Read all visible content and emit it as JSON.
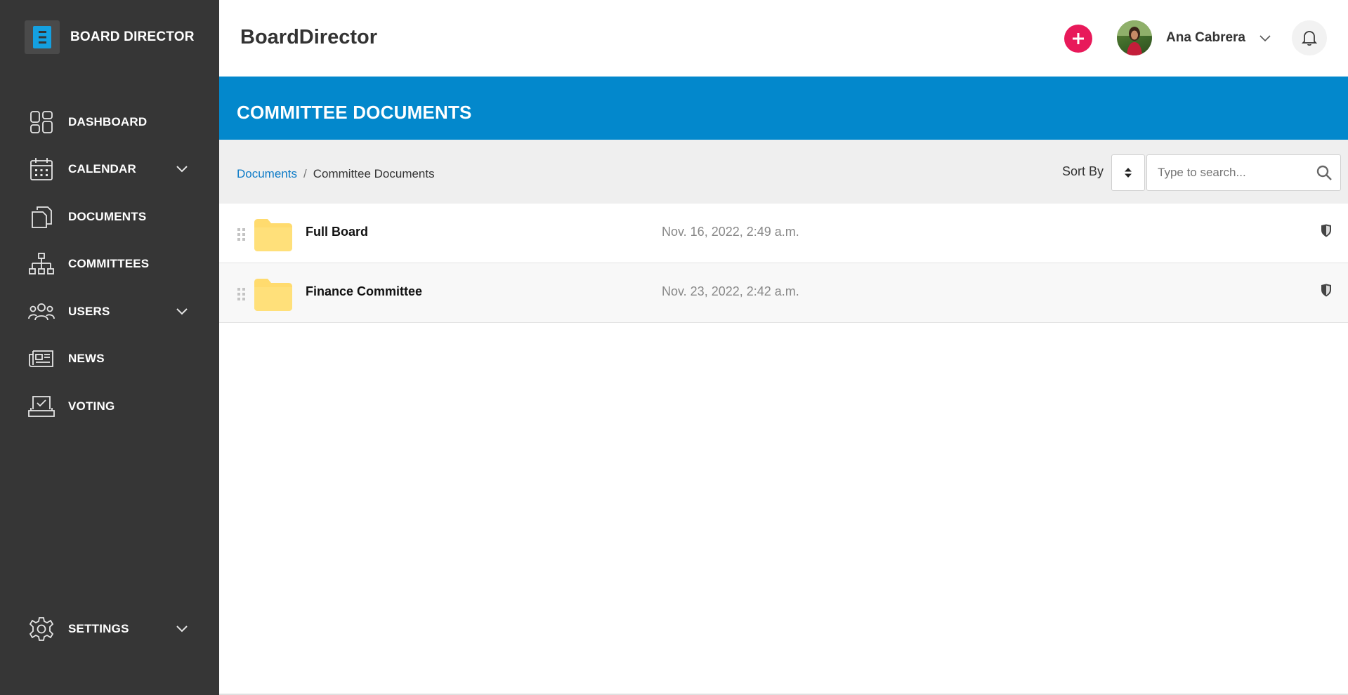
{
  "brand": {
    "name": "BOARD DIRECTOR"
  },
  "sidebar": {
    "items": [
      {
        "label": "DASHBOARD",
        "icon": "dashboard-icon",
        "has_chevron": false
      },
      {
        "label": "CALENDAR",
        "icon": "calendar-icon",
        "has_chevron": true
      },
      {
        "label": "DOCUMENTS",
        "icon": "documents-icon",
        "has_chevron": false
      },
      {
        "label": "COMMITTEES",
        "icon": "org-chart-icon",
        "has_chevron": false
      },
      {
        "label": "USERS",
        "icon": "users-icon",
        "has_chevron": true
      },
      {
        "label": "NEWS",
        "icon": "newspaper-icon",
        "has_chevron": false
      },
      {
        "label": "VOTING",
        "icon": "voting-icon",
        "has_chevron": false
      }
    ],
    "settings": {
      "label": "SETTINGS",
      "icon": "gear-icon",
      "has_chevron": true
    }
  },
  "header": {
    "title": "BoardDirector",
    "user_name": "Ana Cabrera",
    "add_icon": "plus-icon",
    "notifications_icon": "bell-icon"
  },
  "banner": {
    "title": "COMMITTEE DOCUMENTS"
  },
  "toolbar": {
    "breadcrumb": {
      "root": "Documents",
      "separator": "/",
      "current": "Committee Documents"
    },
    "sort_label": "Sort By",
    "search_placeholder": "Type to search..."
  },
  "documents": [
    {
      "name": "Full Board",
      "date": "Nov. 16, 2022, 2:49 a.m."
    },
    {
      "name": "Finance Committee",
      "date": "Nov. 23, 2022, 2:42 a.m."
    }
  ],
  "colors": {
    "sidebar_bg": "#363636",
    "banner_bg": "#0388cc",
    "accent_pink": "#e8195a",
    "folder_yellow": "#ffd966",
    "link_blue": "#0d7bc7"
  }
}
